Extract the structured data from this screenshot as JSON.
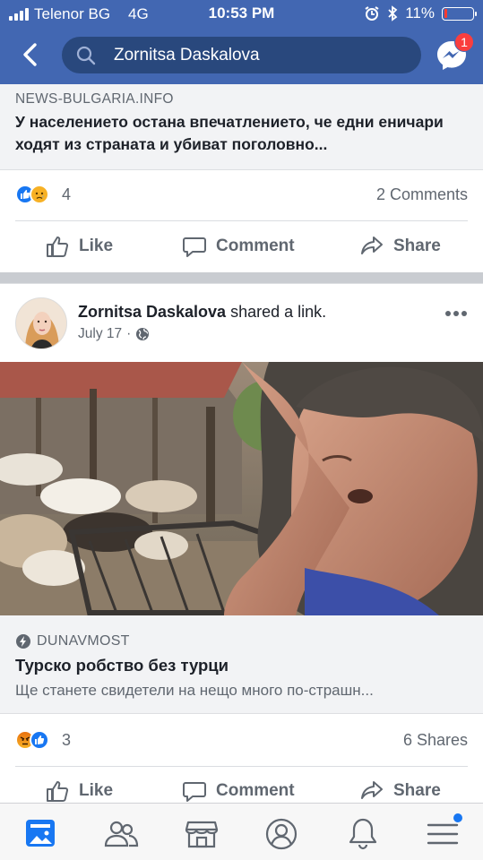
{
  "status_bar": {
    "carrier": "Telenor BG",
    "network": "4G",
    "time": "10:53 PM",
    "battery": "11%",
    "battery_level": 0.11,
    "battery_color": "#ff3b30"
  },
  "header": {
    "search_query": "Zornitsa Daskalova",
    "messenger_badge": "1",
    "brand_color": "#4267b2"
  },
  "prev_post": {
    "link_source": "NEWS-BULGARIA.INFO",
    "link_title": "У населението остана впечатлението, че едни еничари ходят из страната и убиват поголовно...",
    "reaction_count": "4",
    "reaction_icons": [
      "like-icon",
      "sad-icon"
    ],
    "comments": "2 Comments",
    "actions": {
      "like": "Like",
      "comment": "Comment",
      "share": "Share"
    }
  },
  "post": {
    "author": "Zornitsa Daskalova",
    "action_text": "shared a link.",
    "date": "July 17",
    "separator": "·",
    "privacy_icon": "globe-icon",
    "link_source": "DUNAVMOST",
    "link_title": "Турско робство без турци",
    "link_desc": "Ще станете свидетели на нещо много по-страшн...",
    "reaction_count": "3",
    "reaction_icons": [
      "angry-icon",
      "like-icon"
    ],
    "shares": "6 Shares",
    "actions": {
      "like": "Like",
      "comment": "Comment",
      "share": "Share"
    }
  },
  "tabbar": {
    "tabs": [
      "news-feed-icon",
      "friends-icon",
      "marketplace-icon",
      "profile-icon",
      "notifications-icon",
      "menu-icon"
    ],
    "active_tab": "news-feed-icon",
    "menu_dot_color": "#1877f2"
  }
}
